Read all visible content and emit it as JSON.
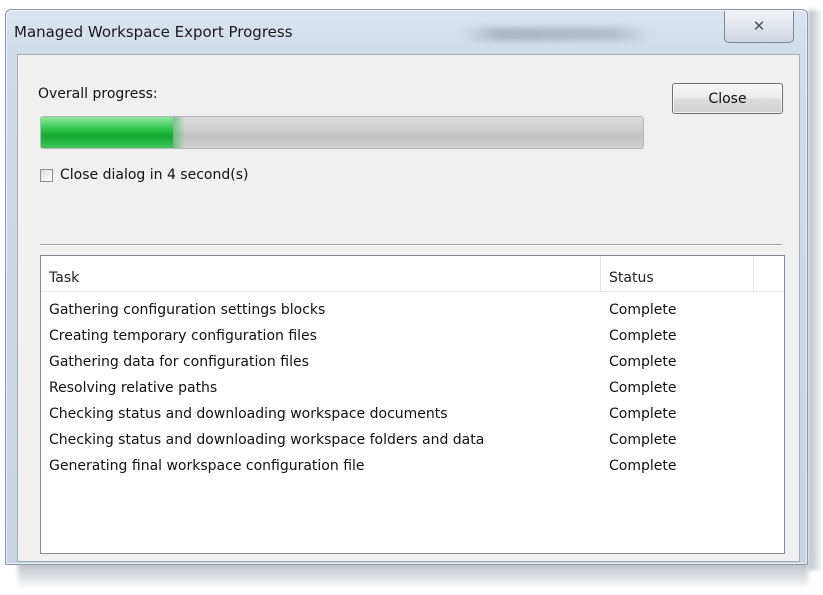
{
  "window": {
    "title": "Managed Workspace Export Progress",
    "close_glyph": "✕"
  },
  "progress": {
    "label": "Overall progress:",
    "fraction": 0.22
  },
  "buttons": {
    "close_label": "Close"
  },
  "auto_close": {
    "label": "Close dialog in 4 second(s)",
    "checked": false
  },
  "table": {
    "columns": {
      "task": "Task",
      "status": "Status"
    },
    "rows": [
      {
        "task": "Gathering configuration settings blocks",
        "status": "Complete"
      },
      {
        "task": "Creating temporary configuration files",
        "status": "Complete"
      },
      {
        "task": "Gathering data for configuration files",
        "status": "Complete"
      },
      {
        "task": "Resolving relative paths",
        "status": "Complete"
      },
      {
        "task": "Checking status and downloading workspace documents",
        "status": "Complete"
      },
      {
        "task": "Checking status and downloading workspace folders and data",
        "status": "Complete"
      },
      {
        "task": "Generating final workspace configuration file",
        "status": "Complete"
      }
    ]
  },
  "colors": {
    "progress_fill": "#1fb43a",
    "window_frame": "#d2dce8"
  }
}
